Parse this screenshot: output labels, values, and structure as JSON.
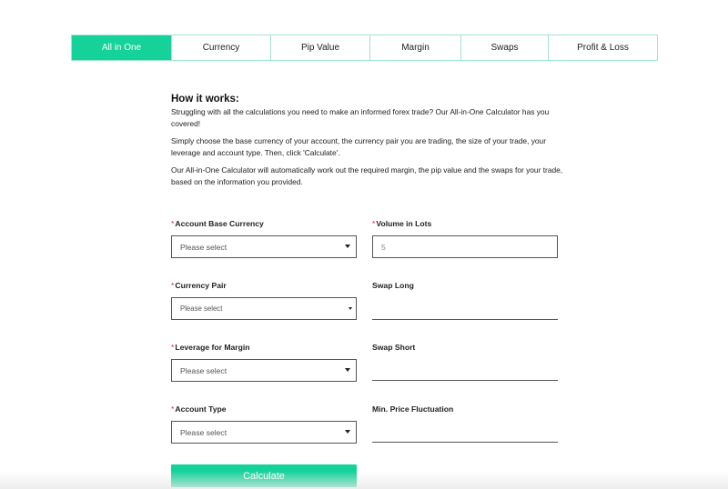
{
  "tabs": [
    "All in One",
    "Currency",
    "Pip Value",
    "Margin",
    "Swaps",
    "Profit & Loss"
  ],
  "active_tab": "All in One",
  "how": {
    "title": "How it works:",
    "p1": "Struggling with all the calculations you need to make an informed forex trade? Our All-in-One Calculator has you covered!",
    "p2": "Simply choose the base currency of your account, the currency pair you are trading, the size of your trade, your leverage and account type. Then, click 'Calculate'.",
    "p3": "Our All-in-One Calculator will automatically work out the required margin, the pip value and the swaps for your trade, based on the information you provided."
  },
  "form": {
    "required_mark": "*",
    "base_currency": {
      "label": "Account Base Currency",
      "value": "Please select"
    },
    "volume": {
      "label": "Volume in Lots",
      "placeholder": "5"
    },
    "currency_pair": {
      "label": "Currency Pair",
      "value": "Please select"
    },
    "swap_long": {
      "label": "Swap Long"
    },
    "leverage": {
      "label": "Leverage for Margin",
      "value": "Please select"
    },
    "swap_short": {
      "label": "Swap Short"
    },
    "account_type": {
      "label": "Account Type",
      "value": "Please select"
    },
    "min_price": {
      "label": "Min. Price Fluctuation"
    },
    "calculate_label": "Calculate"
  },
  "colors": {
    "accent": "#14d29a",
    "tab_border": "#9fe6cd",
    "required": "#e0262d"
  },
  "icons": {
    "dropdown": "caret-down-icon"
  }
}
